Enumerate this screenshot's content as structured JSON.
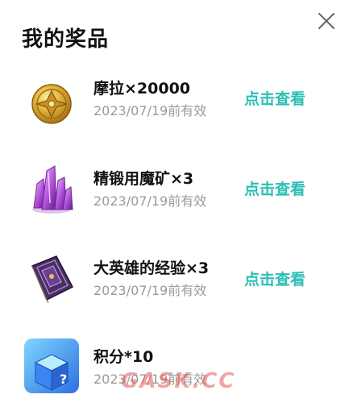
{
  "header": {
    "title": "我的奖品",
    "close_icon": "close-icon"
  },
  "prizes": [
    {
      "icon": "gold-coin-icon",
      "name": "摩拉×20000",
      "validity": "2023/07/19前有效",
      "action_label": "点击查看"
    },
    {
      "icon": "purple-crystal-icon",
      "name": "精锻用魔矿×3",
      "validity": "2023/07/19前有效",
      "action_label": "点击查看"
    },
    {
      "icon": "purple-book-icon",
      "name": "大英雄的经验×3",
      "validity": "2023/07/19前有效",
      "action_label": "点击查看"
    },
    {
      "icon": "mystery-box-icon",
      "name": "积分*10",
      "validity": "2023/07/19前有效",
      "action_label": ""
    }
  ],
  "watermark": "GASK.CC",
  "colors": {
    "accent": "#2bbfb4",
    "title_text": "#111111",
    "secondary_text": "#9a9a9a"
  }
}
